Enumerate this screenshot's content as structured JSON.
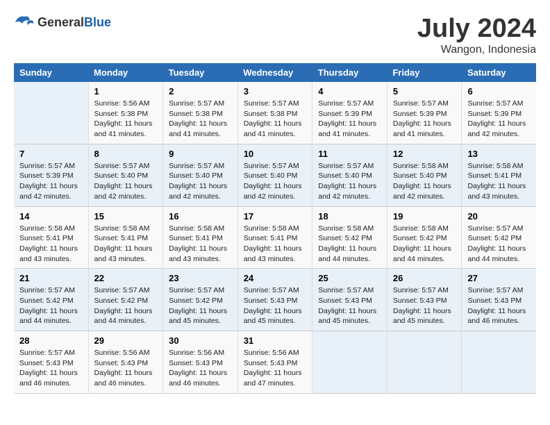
{
  "header": {
    "logo_general": "General",
    "logo_blue": "Blue",
    "month": "July 2024",
    "location": "Wangon, Indonesia"
  },
  "columns": [
    "Sunday",
    "Monday",
    "Tuesday",
    "Wednesday",
    "Thursday",
    "Friday",
    "Saturday"
  ],
  "weeks": [
    [
      {
        "day": "",
        "info": ""
      },
      {
        "day": "1",
        "info": "Sunrise: 5:56 AM\nSunset: 5:38 PM\nDaylight: 11 hours\nand 41 minutes."
      },
      {
        "day": "2",
        "info": "Sunrise: 5:57 AM\nSunset: 5:38 PM\nDaylight: 11 hours\nand 41 minutes."
      },
      {
        "day": "3",
        "info": "Sunrise: 5:57 AM\nSunset: 5:38 PM\nDaylight: 11 hours\nand 41 minutes."
      },
      {
        "day": "4",
        "info": "Sunrise: 5:57 AM\nSunset: 5:39 PM\nDaylight: 11 hours\nand 41 minutes."
      },
      {
        "day": "5",
        "info": "Sunrise: 5:57 AM\nSunset: 5:39 PM\nDaylight: 11 hours\nand 41 minutes."
      },
      {
        "day": "6",
        "info": "Sunrise: 5:57 AM\nSunset: 5:39 PM\nDaylight: 11 hours\nand 42 minutes."
      }
    ],
    [
      {
        "day": "7",
        "info": "Sunrise: 5:57 AM\nSunset: 5:39 PM\nDaylight: 11 hours\nand 42 minutes."
      },
      {
        "day": "8",
        "info": "Sunrise: 5:57 AM\nSunset: 5:40 PM\nDaylight: 11 hours\nand 42 minutes."
      },
      {
        "day": "9",
        "info": "Sunrise: 5:57 AM\nSunset: 5:40 PM\nDaylight: 11 hours\nand 42 minutes."
      },
      {
        "day": "10",
        "info": "Sunrise: 5:57 AM\nSunset: 5:40 PM\nDaylight: 11 hours\nand 42 minutes."
      },
      {
        "day": "11",
        "info": "Sunrise: 5:57 AM\nSunset: 5:40 PM\nDaylight: 11 hours\nand 42 minutes."
      },
      {
        "day": "12",
        "info": "Sunrise: 5:58 AM\nSunset: 5:40 PM\nDaylight: 11 hours\nand 42 minutes."
      },
      {
        "day": "13",
        "info": "Sunrise: 5:58 AM\nSunset: 5:41 PM\nDaylight: 11 hours\nand 43 minutes."
      }
    ],
    [
      {
        "day": "14",
        "info": "Sunrise: 5:58 AM\nSunset: 5:41 PM\nDaylight: 11 hours\nand 43 minutes."
      },
      {
        "day": "15",
        "info": "Sunrise: 5:58 AM\nSunset: 5:41 PM\nDaylight: 11 hours\nand 43 minutes."
      },
      {
        "day": "16",
        "info": "Sunrise: 5:58 AM\nSunset: 5:41 PM\nDaylight: 11 hours\nand 43 minutes."
      },
      {
        "day": "17",
        "info": "Sunrise: 5:58 AM\nSunset: 5:41 PM\nDaylight: 11 hours\nand 43 minutes."
      },
      {
        "day": "18",
        "info": "Sunrise: 5:58 AM\nSunset: 5:42 PM\nDaylight: 11 hours\nand 44 minutes."
      },
      {
        "day": "19",
        "info": "Sunrise: 5:58 AM\nSunset: 5:42 PM\nDaylight: 11 hours\nand 44 minutes."
      },
      {
        "day": "20",
        "info": "Sunrise: 5:57 AM\nSunset: 5:42 PM\nDaylight: 11 hours\nand 44 minutes."
      }
    ],
    [
      {
        "day": "21",
        "info": "Sunrise: 5:57 AM\nSunset: 5:42 PM\nDaylight: 11 hours\nand 44 minutes."
      },
      {
        "day": "22",
        "info": "Sunrise: 5:57 AM\nSunset: 5:42 PM\nDaylight: 11 hours\nand 44 minutes."
      },
      {
        "day": "23",
        "info": "Sunrise: 5:57 AM\nSunset: 5:42 PM\nDaylight: 11 hours\nand 45 minutes."
      },
      {
        "day": "24",
        "info": "Sunrise: 5:57 AM\nSunset: 5:43 PM\nDaylight: 11 hours\nand 45 minutes."
      },
      {
        "day": "25",
        "info": "Sunrise: 5:57 AM\nSunset: 5:43 PM\nDaylight: 11 hours\nand 45 minutes."
      },
      {
        "day": "26",
        "info": "Sunrise: 5:57 AM\nSunset: 5:43 PM\nDaylight: 11 hours\nand 45 minutes."
      },
      {
        "day": "27",
        "info": "Sunrise: 5:57 AM\nSunset: 5:43 PM\nDaylight: 11 hours\nand 46 minutes."
      }
    ],
    [
      {
        "day": "28",
        "info": "Sunrise: 5:57 AM\nSunset: 5:43 PM\nDaylight: 11 hours\nand 46 minutes."
      },
      {
        "day": "29",
        "info": "Sunrise: 5:56 AM\nSunset: 5:43 PM\nDaylight: 11 hours\nand 46 minutes."
      },
      {
        "day": "30",
        "info": "Sunrise: 5:56 AM\nSunset: 5:43 PM\nDaylight: 11 hours\nand 46 minutes."
      },
      {
        "day": "31",
        "info": "Sunrise: 5:56 AM\nSunset: 5:43 PM\nDaylight: 11 hours\nand 47 minutes."
      },
      {
        "day": "",
        "info": ""
      },
      {
        "day": "",
        "info": ""
      },
      {
        "day": "",
        "info": ""
      }
    ]
  ]
}
